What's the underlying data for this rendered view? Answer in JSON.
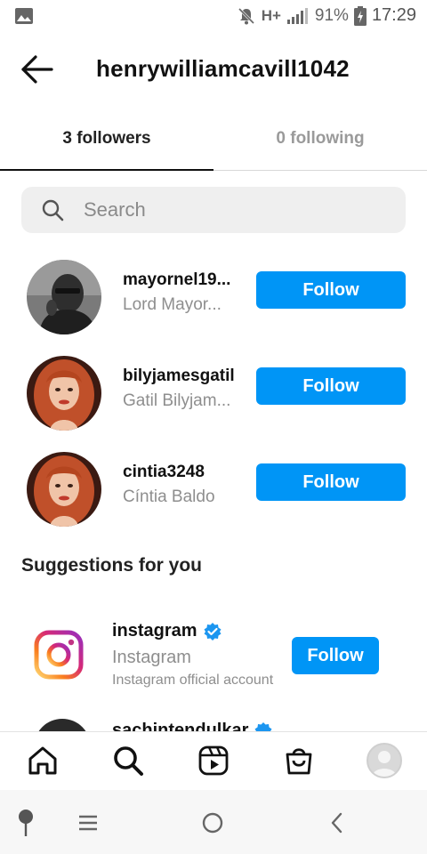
{
  "status_bar": {
    "network": "H+",
    "battery": "91%",
    "time": "17:29"
  },
  "header": {
    "username": "henrywilliamcavill1042"
  },
  "tabs": {
    "followers": "3 followers",
    "following": "0 following"
  },
  "search": {
    "placeholder": "Search"
  },
  "followers": [
    {
      "username": "mayornel19...",
      "fullname": "Lord Mayor...",
      "button": "Follow"
    },
    {
      "username": "bilyjamesgatil",
      "fullname": "Gatil Bilyjam...",
      "button": "Follow"
    },
    {
      "username": "cintia3248",
      "fullname": "Cíntia Baldo",
      "button": "Follow"
    }
  ],
  "suggestions": {
    "title": "Suggestions for you",
    "items": [
      {
        "username": "instagram",
        "fullname": "Instagram",
        "description": "Instagram official account",
        "button": "Follow",
        "verified": true
      },
      {
        "username": "sachintendulkar",
        "verified": true
      }
    ]
  },
  "colors": {
    "accent": "#0095f6",
    "verified": "#1c96f0"
  },
  "bottom_nav": [
    "home-icon",
    "search-icon",
    "reels-icon",
    "shop-icon",
    "profile-avatar"
  ],
  "system_nav": [
    "assistant-icon",
    "recents-icon",
    "home-circle-icon",
    "back-chevron-icon"
  ]
}
